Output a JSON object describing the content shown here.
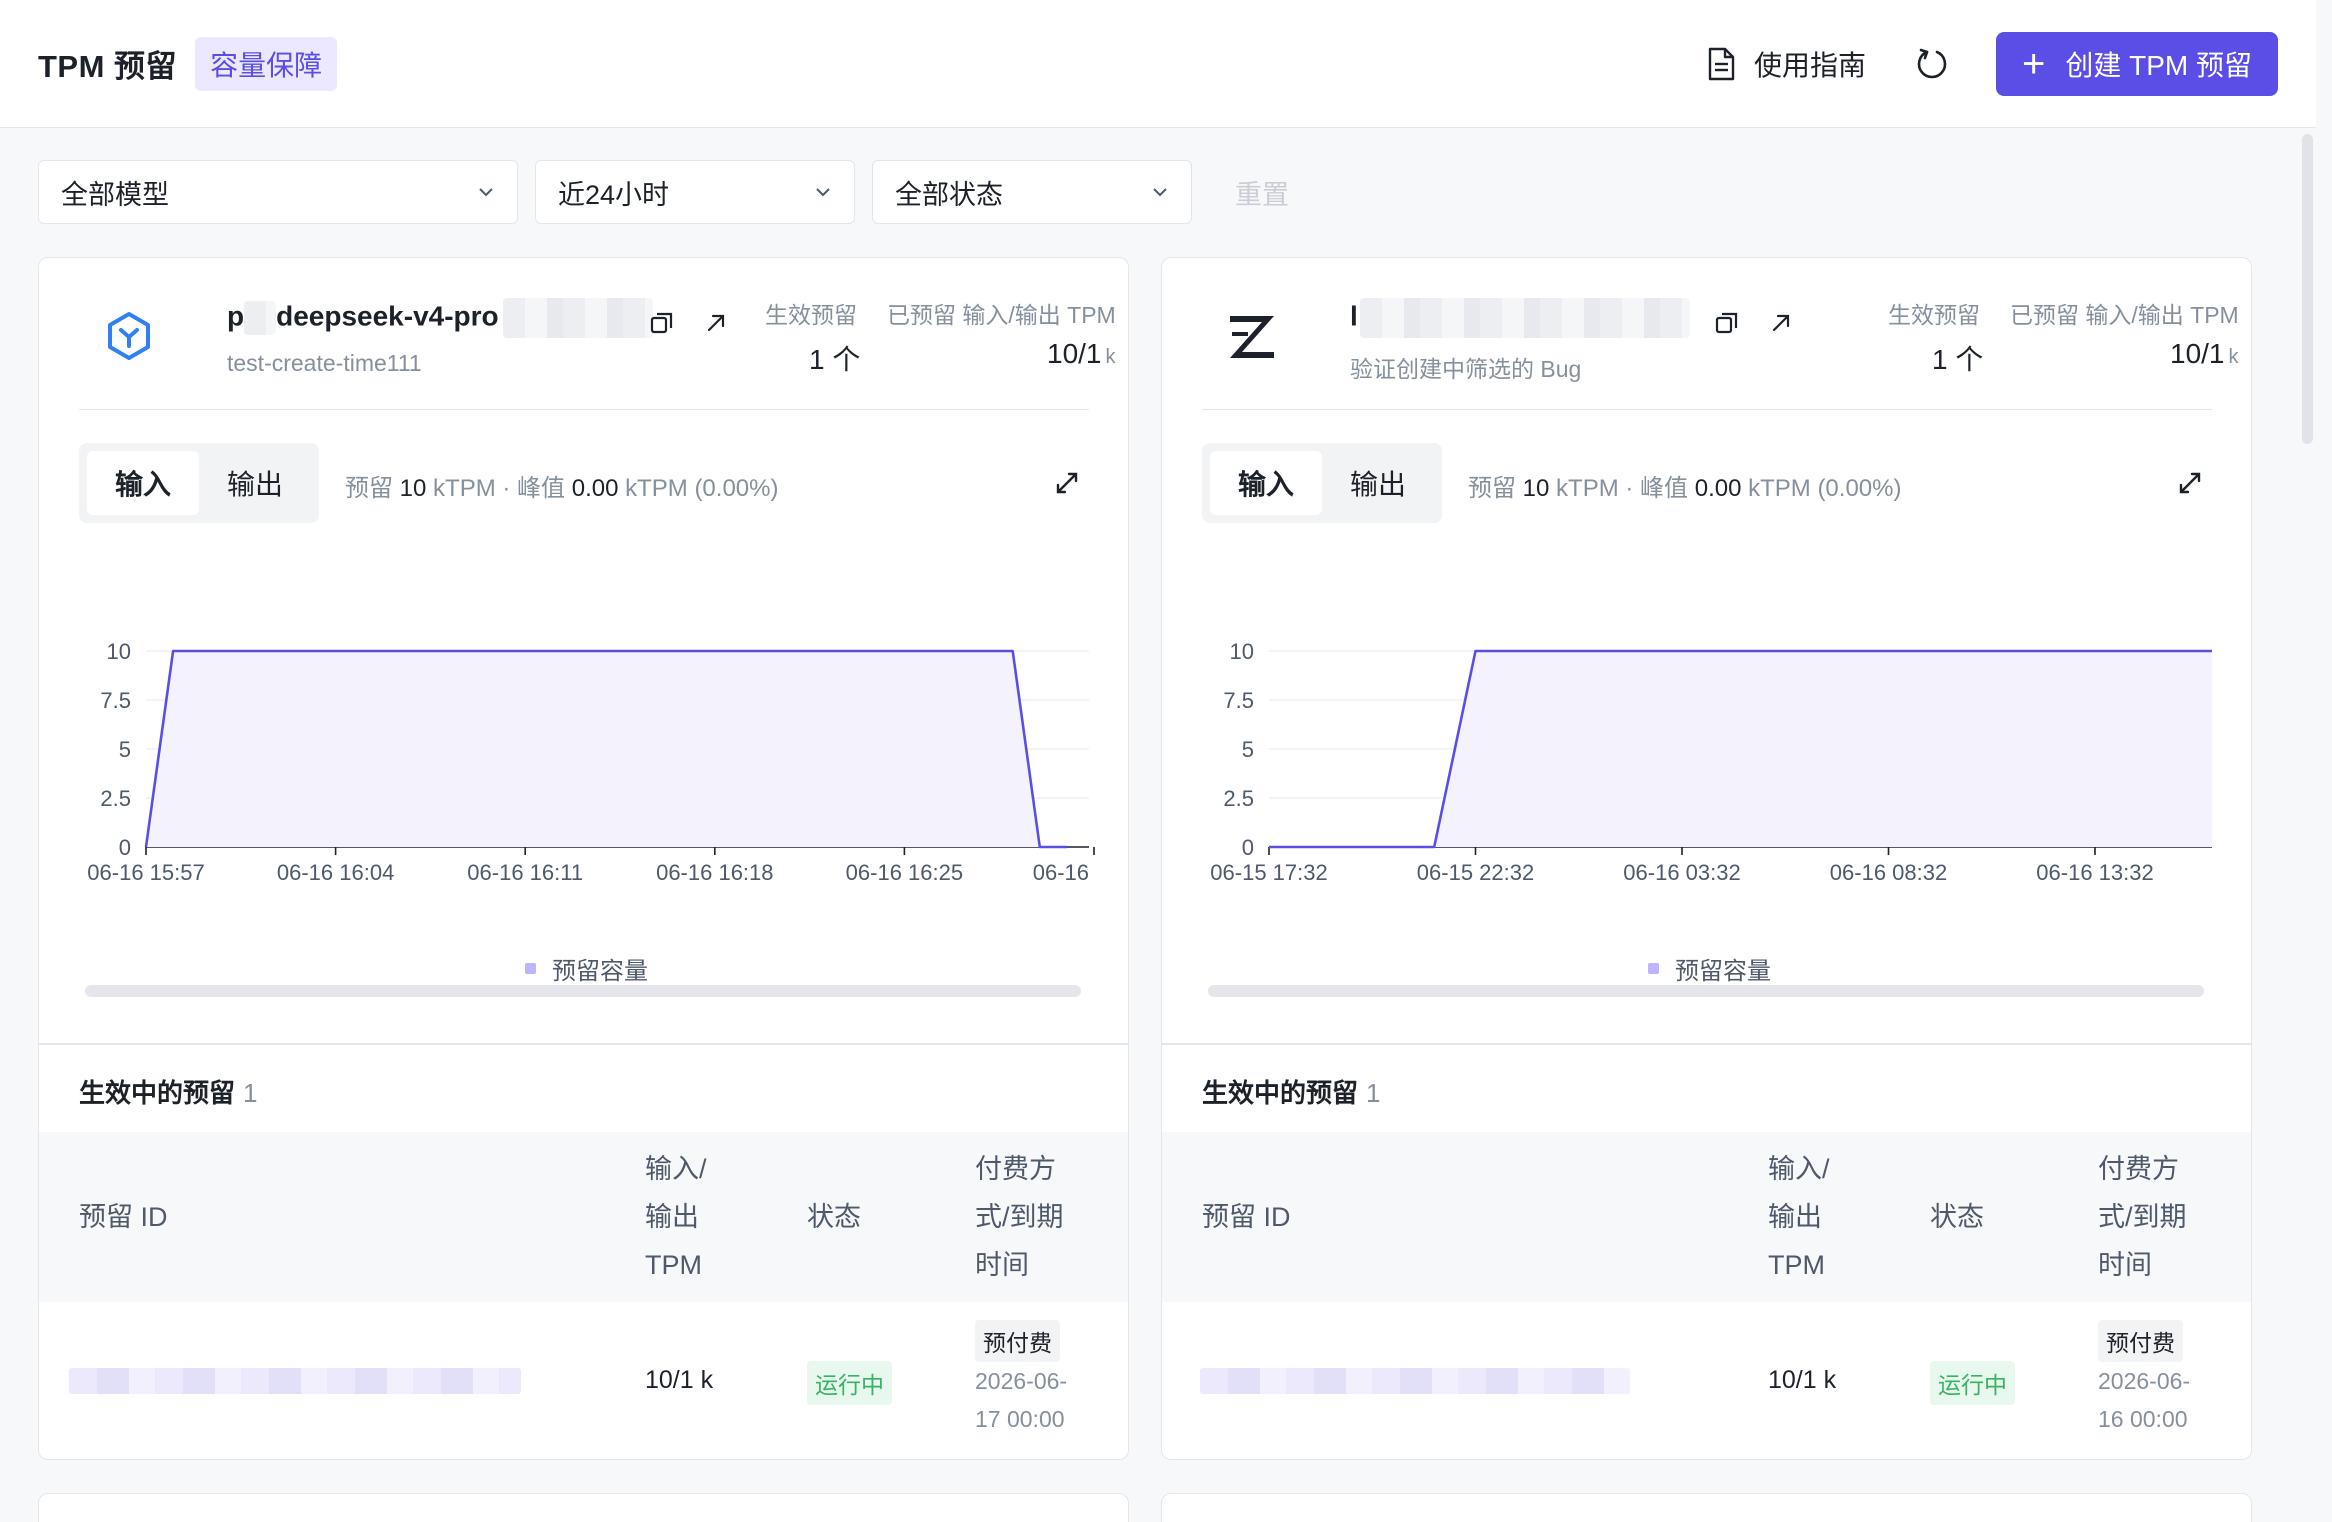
{
  "header": {
    "title": "TPM 预留",
    "badge": "容量保障",
    "guide_label": "使用指南",
    "create_label": "创建 TPM 预留"
  },
  "filters": {
    "model": "全部模型",
    "time": "近24小时",
    "status": "全部状态",
    "reset": "重置"
  },
  "cards": [
    {
      "model_prefix": "p",
      "model_name": "deepseek-v4-pro",
      "description": "test-create-time111",
      "active_label": "生效预留",
      "active_value": "1 个",
      "tpm_label": "已预留 输入/输出 TPM",
      "tpm_value": "10/1",
      "tpm_unit": "k",
      "tab_input": "输入",
      "tab_output": "输出",
      "peak": {
        "p1": "预留",
        "v1": "10",
        "p2": "kTPM · 峰值",
        "v2": "0.00",
        "p3": "kTPM (0.00%)"
      },
      "legend": "预留容量",
      "section_title": "生效中的预留",
      "section_count": "1",
      "columns": {
        "id": "预留 ID",
        "tpm": [
          "输入/",
          "输出",
          "TPM"
        ],
        "status": "状态",
        "pay": [
          "付费方",
          "式/到期",
          "时间"
        ]
      },
      "row": {
        "tpm": "10/1 k",
        "status": "运行中",
        "pay_type": "预付费",
        "expire": [
          "2026-06-",
          "17 00:00"
        ]
      }
    },
    {
      "model_prefix": "l",
      "model_name": "",
      "description": "验证创建中筛选的 Bug",
      "active_label": "生效预留",
      "active_value": "1 个",
      "tpm_label": "已预留 输入/输出 TPM",
      "tpm_value": "10/1",
      "tpm_unit": "k",
      "tab_input": "输入",
      "tab_output": "输出",
      "peak": {
        "p1": "预留",
        "v1": "10",
        "p2": "kTPM · 峰值",
        "v2": "0.00",
        "p3": "kTPM (0.00%)"
      },
      "legend": "预留容量",
      "section_title": "生效中的预留",
      "section_count": "1",
      "columns": {
        "id": "预留 ID",
        "tpm": [
          "输入/",
          "输出",
          "TPM"
        ],
        "status": "状态",
        "pay": [
          "付费方",
          "式/到期",
          "时间"
        ]
      },
      "row": {
        "tpm": "10/1 k",
        "status": "运行中",
        "pay_type": "预付费",
        "expire": [
          "2026-06-",
          "16 00:00"
        ]
      }
    }
  ],
  "colors": {
    "accent": "#5b4ee6",
    "line": "#5b4ee6",
    "area": "#f4f3fd",
    "success": "#36b464"
  },
  "chart_data": [
    {
      "type": "area",
      "series": [
        {
          "name": "预留容量",
          "values": [
            0,
            10,
            10,
            0,
            0
          ]
        }
      ],
      "x": [
        "06-16 15:57",
        "06-16 15:58",
        "06-16 16:29",
        "06-16 16:30",
        "06-16 16:31"
      ],
      "x_tick_labels": [
        "06-16 15:57",
        "06-16 16:04",
        "06-16 16:11",
        "06-16 16:18",
        "06-16 16:25",
        "06-16"
      ],
      "y_ticks": [
        "0",
        "2.5",
        "5",
        "7.5",
        "10"
      ],
      "ylim": [
        0,
        10
      ],
      "legend_position": "bottom-center",
      "grid": true
    },
    {
      "type": "area",
      "series": [
        {
          "name": "预留容量",
          "values": [
            0,
            0,
            10,
            10
          ]
        }
      ],
      "x": [
        "06-15 17:32",
        "06-15 21:32",
        "06-15 22:32",
        "06-16 16:00"
      ],
      "x_tick_labels": [
        "06-15 17:32",
        "06-15 22:32",
        "06-16 03:32",
        "06-16 08:32",
        "06-16 13:32"
      ],
      "y_ticks": [
        "0",
        "2.5",
        "5",
        "7.5",
        "10"
      ],
      "ylim": [
        0,
        10
      ],
      "legend_position": "bottom-center",
      "grid": true
    }
  ]
}
